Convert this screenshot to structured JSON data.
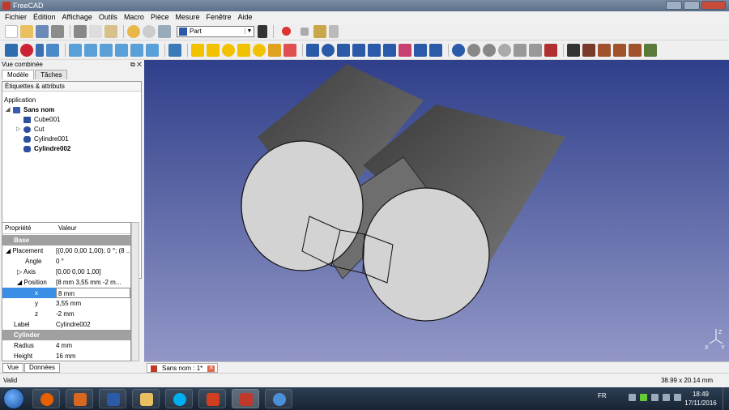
{
  "window": {
    "title": "FreeCAD"
  },
  "menu": [
    "Fichier",
    "Édition",
    "Affichage",
    "Outils",
    "Macro",
    "Pièce",
    "Mesure",
    "Fenêtre",
    "Aide"
  ],
  "workbench": {
    "selected": "Part"
  },
  "combo": {
    "title": "Vue combinée",
    "tabs": [
      "Modèle",
      "Tâches"
    ],
    "tree_header": "Étiquettes & attributs",
    "tree_root": "Application",
    "document": "Sans nom",
    "objects": [
      "Cube001",
      "Cut",
      "Cylindre001",
      "Cylindre002"
    ]
  },
  "props": {
    "col_property": "Propriété",
    "col_value": "Valeur",
    "rows": [
      {
        "name": "Base",
        "value": "",
        "group": true
      },
      {
        "name": "Placement",
        "value": "[(0,00 0,00 1,00); 0 °; (8 ..."
      },
      {
        "name": "Angle",
        "value": "0 °"
      },
      {
        "name": "Axis",
        "value": "[0,00 0,00 1,00]"
      },
      {
        "name": "Position",
        "value": "[8 mm  3,55 mm  -2 m..."
      },
      {
        "name": "x",
        "value": "8 mm"
      },
      {
        "name": "y",
        "value": "3,55 mm"
      },
      {
        "name": "z",
        "value": "-2 mm"
      },
      {
        "name": "Label",
        "value": "Cylindre002"
      },
      {
        "name": "Cylinder",
        "value": "",
        "group": true
      },
      {
        "name": "Radius",
        "value": "4 mm"
      },
      {
        "name": "Height",
        "value": "16 mm"
      }
    ]
  },
  "bottom_tabs": [
    "Vue",
    "Données"
  ],
  "doc_tab": {
    "label": "Sans nom : 1*"
  },
  "status": {
    "left": "Valid",
    "dimensions": "38.99 x 20.14 mm"
  },
  "axes": {
    "x": "X",
    "y": "Y",
    "z": "Z"
  },
  "taskbar": {
    "lang": "FR",
    "time": "18:49",
    "date": "17/11/2016"
  },
  "colors": {
    "viewport_top": "#2f3f8a",
    "viewport_bottom": "#9297c7",
    "tree_icon": "#2c4fa0"
  }
}
